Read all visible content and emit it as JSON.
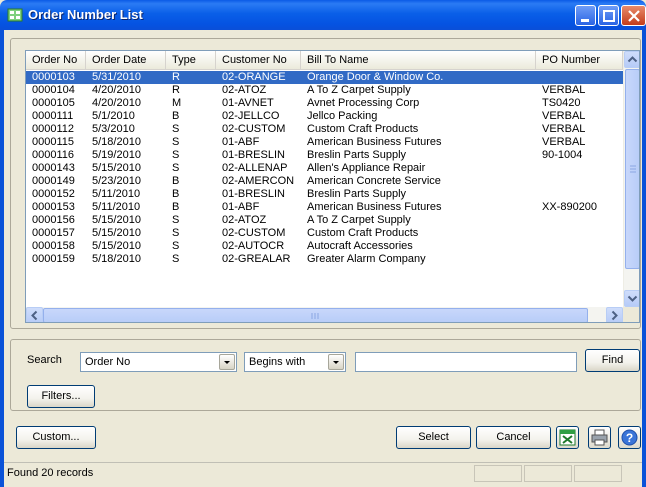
{
  "window": {
    "title": "Order Number List"
  },
  "list": {
    "columns": [
      "Order No",
      "Order Date",
      "Type",
      "Customer No",
      "Bill To Name",
      "PO Number"
    ],
    "rows": [
      [
        "0000103",
        "5/31/2010",
        "R",
        "02-ORANGE",
        "Orange Door & Window Co.",
        ""
      ],
      [
        "0000104",
        "4/20/2010",
        "R",
        "02-ATOZ",
        "A To Z Carpet Supply",
        "VERBAL"
      ],
      [
        "0000105",
        "4/20/2010",
        "M",
        "01-AVNET",
        "Avnet Processing Corp",
        "TS0420"
      ],
      [
        "0000111",
        "5/1/2010",
        "B",
        "02-JELLCO",
        "Jellco Packing",
        "VERBAL"
      ],
      [
        "0000112",
        "5/3/2010",
        "S",
        "02-CUSTOM",
        "Custom Craft Products",
        "VERBAL"
      ],
      [
        "0000115",
        "5/18/2010",
        "S",
        "01-ABF",
        "American Business Futures",
        "VERBAL"
      ],
      [
        "0000116",
        "5/19/2010",
        "S",
        "01-BRESLIN",
        "Breslin Parts Supply",
        "90-1004"
      ],
      [
        "0000143",
        "5/15/2010",
        "S",
        "02-ALLENAP",
        "Allen's Appliance Repair",
        ""
      ],
      [
        "0000149",
        "5/23/2010",
        "B",
        "02-AMERCON",
        "American Concrete Service",
        ""
      ],
      [
        "0000152",
        "5/11/2010",
        "B",
        "01-BRESLIN",
        "Breslin Parts Supply",
        ""
      ],
      [
        "0000153",
        "5/11/2010",
        "B",
        "01-ABF",
        "American Business Futures",
        "XX-890200"
      ],
      [
        "0000156",
        "5/15/2010",
        "S",
        "02-ATOZ",
        "A To Z Carpet Supply",
        ""
      ],
      [
        "0000157",
        "5/15/2010",
        "S",
        "02-CUSTOM",
        "Custom Craft Products",
        ""
      ],
      [
        "0000158",
        "5/15/2010",
        "S",
        "02-AUTOCR",
        "Autocraft Accessories",
        ""
      ],
      [
        "0000159",
        "5/18/2010",
        "S",
        "02-GREALAR",
        "Greater Alarm Company",
        ""
      ]
    ],
    "selected_row": 0
  },
  "search": {
    "label": "Search",
    "field_value": "Order No",
    "operator_value": "Begins with",
    "text_value": "",
    "find_label": "Find",
    "filters_label": "Filters..."
  },
  "buttons": {
    "custom_label": "Custom...",
    "select_label": "Select",
    "cancel_label": "Cancel"
  },
  "status": {
    "text": "Found 20 records"
  },
  "icons": {
    "app": "order-list-app-icon",
    "export": "excel-export-icon",
    "print": "printer-icon",
    "help": "help-icon"
  }
}
